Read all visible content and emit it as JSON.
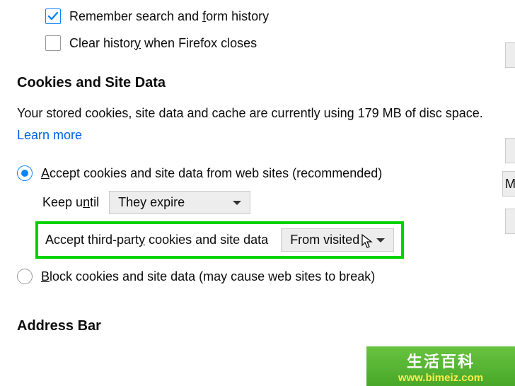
{
  "history": {
    "remember_label_pre": "Remember search and ",
    "remember_label_u": "f",
    "remember_label_post": "orm history",
    "clear_label_pre": "Clear histor",
    "clear_label_u": "y",
    "clear_label_post": " when Firefox closes"
  },
  "cookies": {
    "title": "Cookies and Site Data",
    "desc_pre": "Your stored cookies, site data and cache are currently using ",
    "desc_size": "179 MB",
    "desc_post": " of disc space.  ",
    "learn_more": "Learn more",
    "accept_label_u": "A",
    "accept_label_post": "ccept cookies and site data from web sites (recommended)",
    "keep_label_pre": "Keep u",
    "keep_label_u": "n",
    "keep_label_post": "til",
    "keep_value": "They expire",
    "third_party_label_pre": "Accept third-part",
    "third_party_label_u": "y",
    "third_party_label_post": " cookies and site data",
    "third_party_value": "From visited",
    "block_label_u": "B",
    "block_label_post": "lock cookies and site data (may cause web sites to break)"
  },
  "addressbar": {
    "title": "Address Bar"
  },
  "edge_buttons": {
    "m_label": "M"
  },
  "watermark": {
    "top": "生活百科",
    "url": "www.bimeiz.com"
  }
}
